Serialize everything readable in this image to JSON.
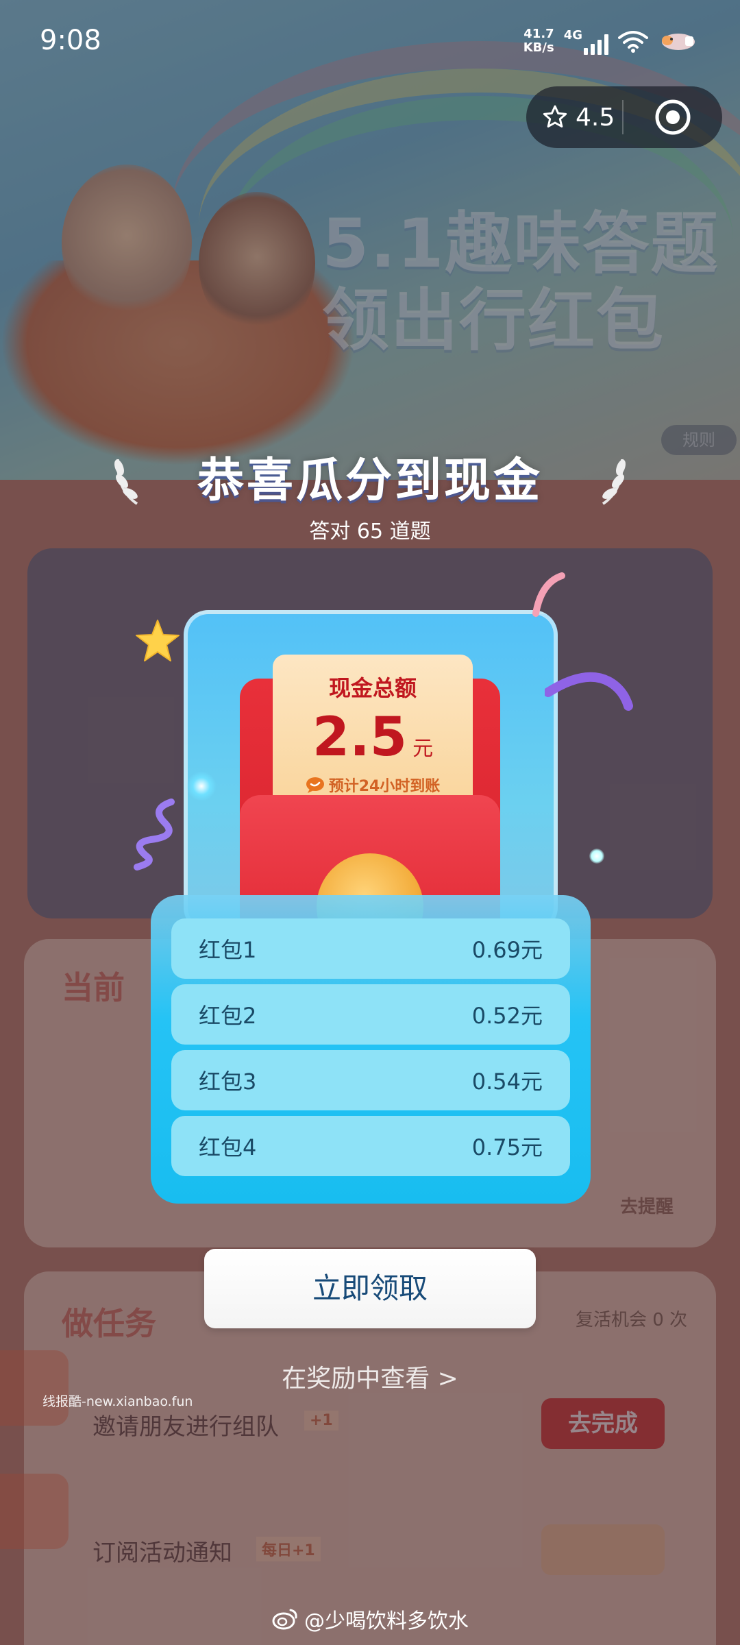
{
  "status_bar": {
    "time": "9:08",
    "net_speed_value": "41.7",
    "net_speed_unit": "KB/s",
    "network": "4G",
    "icons": [
      "signal-icon",
      "wifi-icon",
      "battery-icon"
    ]
  },
  "capsule": {
    "rating": "4.5",
    "icons": [
      "star-icon",
      "target-icon"
    ]
  },
  "background": {
    "banner_title_line1": "5.1趣味答题",
    "banner_title_line2": "领出行红包",
    "rules_chip": "规则",
    "section_task_title": "做任务",
    "revive_text": "复活机会 0 次",
    "task_invite": "邀请朋友进行组队",
    "task_invite_badge": "+1",
    "task_invite_button": "去完成",
    "task_subscribe": "订阅活动通知",
    "task_subscribe_badge": "每日+1",
    "section_current_title": "当前",
    "remind_button": "去提醒"
  },
  "modal": {
    "title": "恭喜瓜分到现金",
    "subtitle": "答对 65 道题",
    "cash_label": "现金总额",
    "cash_amount": "2.5",
    "cash_unit": "元",
    "cash_eta": "预计24小时到账",
    "packets": [
      {
        "name": "红包1",
        "amount": "0.69元"
      },
      {
        "name": "红包2",
        "amount": "0.52元"
      },
      {
        "name": "红包3",
        "amount": "0.54元"
      },
      {
        "name": "红包4",
        "amount": "0.75元"
      }
    ],
    "claim_button": "立即领取",
    "view_rewards": "在奖励中查看 >"
  },
  "watermarks": {
    "site": "线报酷-new.xianbao.fun",
    "weibo": "@少喝饮料多饮水"
  },
  "colors": {
    "accent_blue": "#18bdf0",
    "cash_red": "#c0171f",
    "packet_red": "#e22a35"
  }
}
